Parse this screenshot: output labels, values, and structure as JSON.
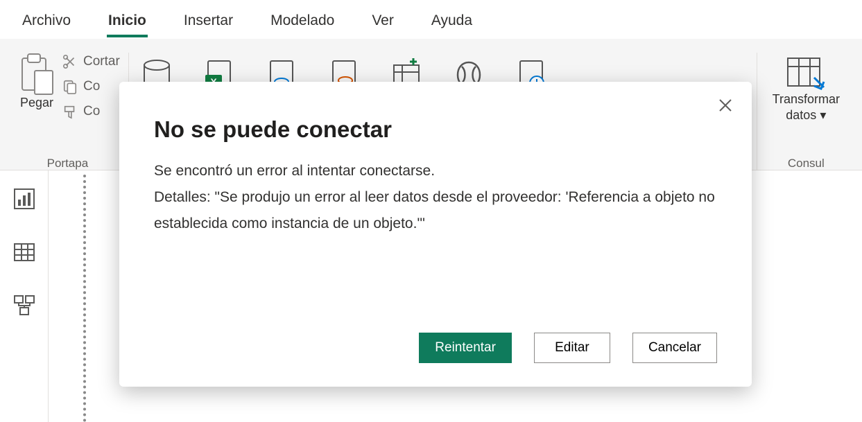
{
  "tabs": {
    "archivo": "Archivo",
    "inicio": "Inicio",
    "insertar": "Insertar",
    "modelado": "Modelado",
    "ver": "Ver",
    "ayuda": "Ayuda"
  },
  "ribbon": {
    "paste": "Pegar",
    "cut": "Cortar",
    "copy": "Co",
    "format_painter": "Co",
    "clipboard_group": "Portapa",
    "transform_l1": "Transformar",
    "transform_l2": "datos",
    "queries_group": "Consul"
  },
  "dialog": {
    "title": "No se puede conectar",
    "body_l1": "Se encontró un error al intentar conectarse.",
    "body_l2": "Detalles: \"Se produjo un error al leer datos desde el proveedor: 'Referencia a objeto no establecida como instancia de un objeto.'\"",
    "retry": "Reintentar",
    "edit": "Editar",
    "cancel": "Cancelar"
  }
}
